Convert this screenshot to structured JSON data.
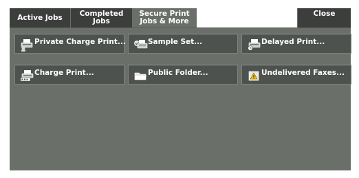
{
  "tabs": {
    "active_jobs": "Active Jobs",
    "completed_line1": "Completed",
    "completed_line2": "Jobs",
    "secure_line1": "Secure Print",
    "secure_line2": "Jobs & More"
  },
  "close_label": "Close",
  "buttons": {
    "private_charge_print": "Private Charge Print...",
    "sample_set": "Sample Set...",
    "delayed_print": "Delayed Print...",
    "charge_print": "Charge Print...",
    "public_folder": "Public Folder...",
    "undelivered_faxes": "Undelivered Faxes..."
  },
  "icons": {
    "private_charge_print": "printer-user-icon",
    "sample_set": "printer-check-icon",
    "delayed_print": "printer-clock-icon",
    "charge_print": "printer-counter-icon",
    "public_folder": "folder-icon",
    "undelivered_faxes": "warning-fax-icon"
  },
  "colors": {
    "panel": "#6b6f6a",
    "tab_inactive": "#3b3e3b",
    "button": "#4e524e"
  }
}
